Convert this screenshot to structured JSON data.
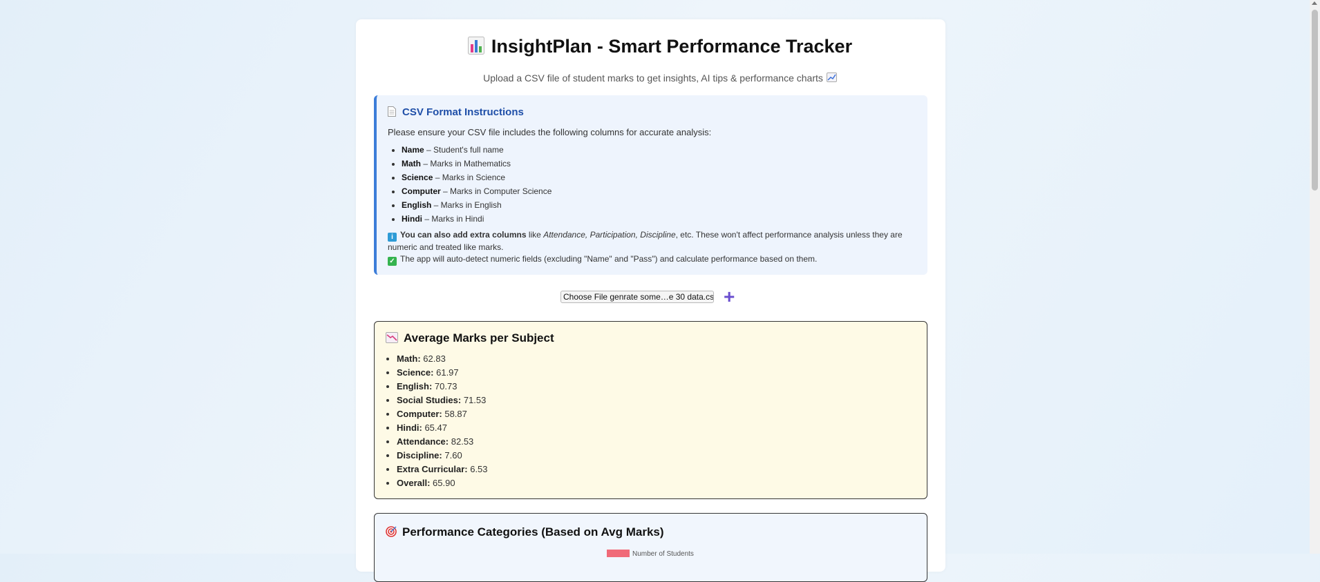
{
  "header": {
    "title": "InsightPlan - Smart Performance Tracker",
    "subtitle": "Upload a CSV file of student marks to get insights, AI tips & performance charts"
  },
  "instructions": {
    "title": "CSV Format Instructions",
    "intro": "Please ensure your CSV file includes the following columns for accurate analysis:",
    "columns": [
      {
        "name": "Name",
        "desc": " – Student's full name"
      },
      {
        "name": "Math",
        "desc": " – Marks in Mathematics"
      },
      {
        "name": "Science",
        "desc": " – Marks in Science"
      },
      {
        "name": "Computer",
        "desc": " – Marks in Computer Science"
      },
      {
        "name": "English",
        "desc": " – Marks in English"
      },
      {
        "name": "Hindi",
        "desc": " – Marks in Hindi"
      }
    ],
    "extra_bold": "You can also add extra columns",
    "extra_pre": " like ",
    "extra_italic": "Attendance, Participation, Discipline",
    "extra_post": ", etc. These won't affect performance analysis unless they are numeric and treated like marks.",
    "autodetect": "The app will auto-detect numeric fields (excluding \"Name\" and \"Pass\") and calculate performance based on them."
  },
  "upload": {
    "file_label": "Choose File genrate some…e 30 data.csv",
    "add_label": "+"
  },
  "averages": {
    "title": "Average Marks per Subject",
    "items": [
      {
        "subject": "Math:",
        "value": "62.83"
      },
      {
        "subject": "Science:",
        "value": "61.97"
      },
      {
        "subject": "English:",
        "value": "70.73"
      },
      {
        "subject": "Social Studies:",
        "value": "71.53"
      },
      {
        "subject": "Computer:",
        "value": "58.87"
      },
      {
        "subject": "Hindi:",
        "value": "65.47"
      },
      {
        "subject": "Attendance:",
        "value": "82.53"
      },
      {
        "subject": "Discipline:",
        "value": "7.60"
      },
      {
        "subject": "Extra Curricular:",
        "value": "6.53"
      },
      {
        "subject": "Overall:",
        "value": "65.90"
      }
    ]
  },
  "performance": {
    "title": "Performance Categories (Based on Avg Marks)",
    "legend_label": "Number of Students",
    "legend_color": "#f06a78"
  },
  "colors": {
    "accent": "#3c7dd9",
    "heading_blue": "#1f4fa8",
    "plus": "#6a4fcf",
    "avg_bg": "#fefae6"
  },
  "icons": [
    "bar-chart-icon",
    "chart-up-icon",
    "document-icon",
    "info-square-icon",
    "check-square-icon",
    "chart-down-icon",
    "target-icon"
  ]
}
